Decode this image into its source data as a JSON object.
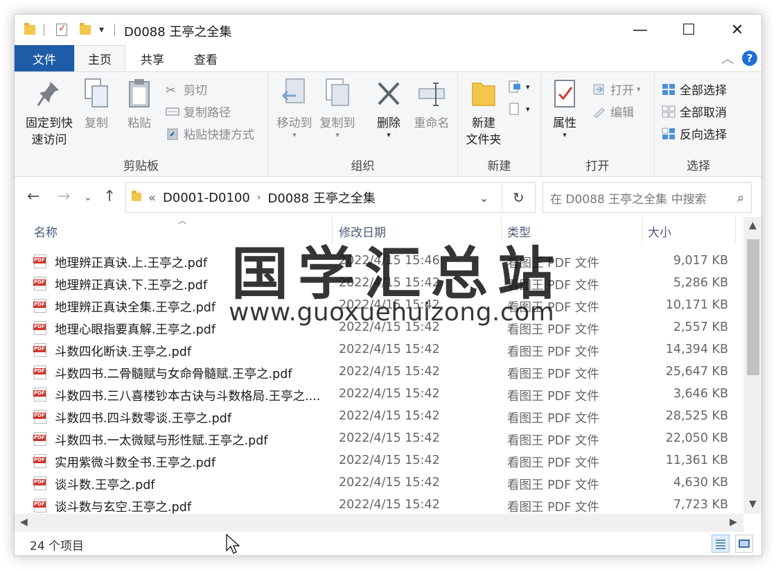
{
  "window": {
    "title": "D0088 王亭之全集",
    "controls": {
      "minimize": "—",
      "maximize": "☐",
      "close": "✕"
    }
  },
  "ribbon_tabs": [
    {
      "label": "文件"
    },
    {
      "label": "主页"
    },
    {
      "label": "共享"
    },
    {
      "label": "查看"
    }
  ],
  "ribbon": {
    "clipboard": {
      "group_label": "剪贴板",
      "pin_line1": "固定到快",
      "pin_line2": "速访问",
      "copy": "复制",
      "paste": "粘贴",
      "cut": "剪切",
      "copy_path": "复制路径",
      "paste_shortcut": "粘贴快捷方式"
    },
    "organize": {
      "group_label": "组织",
      "move_to": "移动到",
      "copy_to": "复制到",
      "delete": "删除",
      "rename": "重命名"
    },
    "new": {
      "group_label": "新建",
      "new_folder_line1": "新建",
      "new_folder_line2": "文件夹"
    },
    "open": {
      "group_label": "打开",
      "properties": "属性",
      "open": "打开",
      "edit": "编辑"
    },
    "select": {
      "group_label": "选择",
      "select_all": "全部选择",
      "select_none": "全部取消",
      "invert": "反向选择"
    }
  },
  "address": {
    "prefix": "«",
    "crumbs": [
      "D0001-D0100",
      "D0088 王亭之全集"
    ],
    "search_placeholder": "在 D0088 王亭之全集 中搜索"
  },
  "columns": {
    "name": "名称",
    "date": "修改日期",
    "type": "类型",
    "size": "大小"
  },
  "files": [
    {
      "name": "地理辨正真诀.上.王亭之.pdf",
      "date": "2022/4/15 15:46",
      "type": "看图王 PDF 文件",
      "size": "9,017 KB"
    },
    {
      "name": "地理辨正真诀.下.王亭之.pdf",
      "date": "2022/4/15 15:42",
      "type": "看图王 PDF 文件",
      "size": "5,286 KB"
    },
    {
      "name": "地理辨正真诀全集.王亭之.pdf",
      "date": "2022/4/15 15:42",
      "type": "看图王 PDF 文件",
      "size": "10,171 KB"
    },
    {
      "name": "地理心眼指要真解.王亭之.pdf",
      "date": "2022/4/15 15:42",
      "type": "看图王 PDF 文件",
      "size": "2,557 KB"
    },
    {
      "name": "斗数四化断诀.王亭之.pdf",
      "date": "2022/4/15 15:42",
      "type": "看图王 PDF 文件",
      "size": "14,394 KB"
    },
    {
      "name": "斗数四书.二骨髓赋与女命骨髓赋.王亭之.pdf",
      "date": "2022/4/15 15:42",
      "type": "看图王 PDF 文件",
      "size": "25,647 KB"
    },
    {
      "name": "斗数四书.三八喜楼钞本古诀与斗数格局.王亭之....",
      "date": "2022/4/15 15:42",
      "type": "看图王 PDF 文件",
      "size": "3,646 KB"
    },
    {
      "name": "斗数四书.四斗数零谈.王亭之.pdf",
      "date": "2022/4/15 15:42",
      "type": "看图王 PDF 文件",
      "size": "28,525 KB"
    },
    {
      "name": "斗数四书.一太微赋与形性赋.王亭之.pdf",
      "date": "2022/4/15 15:42",
      "type": "看图王 PDF 文件",
      "size": "22,050 KB"
    },
    {
      "name": "实用紫微斗数全书.王亭之.pdf",
      "date": "2022/4/15 15:42",
      "type": "看图王 PDF 文件",
      "size": "11,361 KB"
    },
    {
      "name": "谈斗数.王亭之.pdf",
      "date": "2022/4/15 15:42",
      "type": "看图王 PDF 文件",
      "size": "4,630 KB"
    },
    {
      "name": "谈斗数与玄空.王亭之.pdf",
      "date": "2022/4/15 15:42",
      "type": "看图王 PDF 文件",
      "size": "7,723 KB"
    }
  ],
  "status": {
    "item_count": "24 个项目"
  },
  "watermark": {
    "line1": "国学汇总站",
    "line2": "www.guoxuehuizong.com"
  }
}
